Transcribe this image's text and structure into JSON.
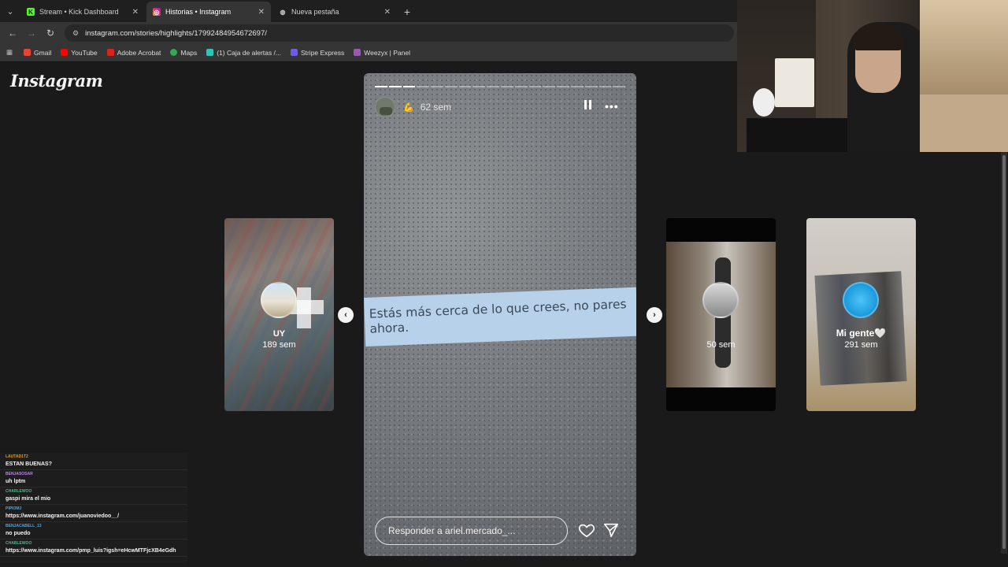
{
  "browser": {
    "tabs": [
      {
        "title": "Stream • Kick Dashboard",
        "active": false,
        "icon": "kick-icon"
      },
      {
        "title": "Historias • Instagram",
        "active": true,
        "icon": "instagram-icon"
      },
      {
        "title": "Nueva pestaña",
        "active": false,
        "icon": "globe-icon"
      }
    ],
    "url": "instagram.com/stories/highlights/17992484954672697/",
    "bookmarks": [
      {
        "label": "Gmail",
        "color": "#ea4335"
      },
      {
        "label": "YouTube",
        "color": "#ff0000"
      },
      {
        "label": "Adobe Acrobat",
        "color": "#d9251c"
      },
      {
        "label": "Maps",
        "color": "#34a853"
      },
      {
        "label": "(1) Caja de alertas /...",
        "color": "#2ec4b6"
      },
      {
        "label": "Stripe Express",
        "color": "#6c5ce7"
      },
      {
        "label": "Weezyx | Panel",
        "color": "#9b59b6"
      }
    ]
  },
  "instagram": {
    "logo": "Instagram",
    "story": {
      "time": "62 sem",
      "caption_line1": "Estás más cerca de lo que crees, no pares",
      "caption_line2": "ahora.",
      "reply_placeholder": "Responder a ariel.mercado_...",
      "progress_total": 18,
      "progress_done": 3
    },
    "prev": {
      "name": "UY",
      "time": "189 sem"
    },
    "next": [
      {
        "name": "",
        "time": "50 sem"
      },
      {
        "name": "Mi gente🤍",
        "time": "291 sem"
      }
    ]
  },
  "chat": [
    {
      "user": "LAUTAD1T2",
      "color": "#d4a017",
      "text": "ESTAN BUENAS?"
    },
    {
      "user": "BENJASOSAR",
      "color": "#c77dff",
      "text": "uh lptm"
    },
    {
      "user": "CHARLEWOO",
      "color": "#52b788",
      "text": "gaspi mira el mio"
    },
    {
      "user": "PIPIOMJ",
      "color": "#4ea8de",
      "text": "https://www.instagram.com/juanoviedoo__/"
    },
    {
      "user": "BENJACABELL_13",
      "color": "#4ea8de",
      "text": "no puedo"
    },
    {
      "user": "CHARLEWOO",
      "color": "#52b788",
      "text": "https://www.instagram.com/pmp_luis?igsh=eHcwMTFjcXB4eGdh"
    }
  ]
}
